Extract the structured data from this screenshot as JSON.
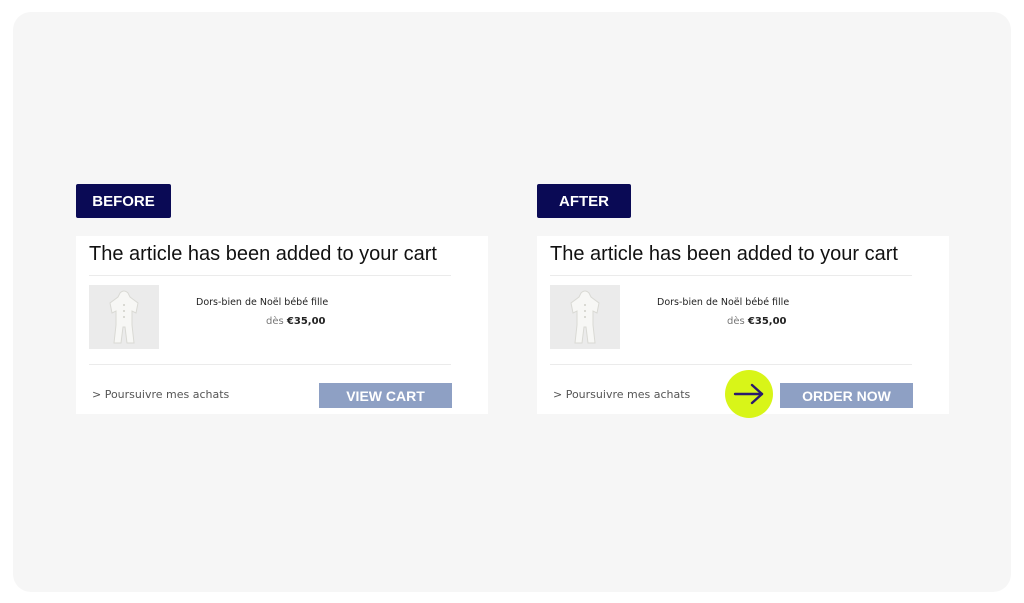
{
  "before": {
    "badge": "BEFORE",
    "title": "The article has been added to your cart",
    "product_name": "Dors-bien de Noël bébé fille",
    "price_prefix": "dès",
    "price": "€35,00",
    "continue_link": "> Poursuivre mes achats",
    "cta_label": "VIEW CART"
  },
  "after": {
    "badge": "AFTER",
    "title": "The article has been added to your cart",
    "product_name": "Dors-bien de Noël bébé fille",
    "price_prefix": "dès",
    "price": "€35,00",
    "continue_link": "> Poursuivre mes achats",
    "cta_label": "ORDER NOW",
    "highlight_icon": "arrow-right-icon"
  },
  "colors": {
    "badge_bg": "#0a0a55",
    "cta_bg": "#8ea0c4",
    "highlight": "#d8f518",
    "arrow": "#2a1a6e"
  }
}
